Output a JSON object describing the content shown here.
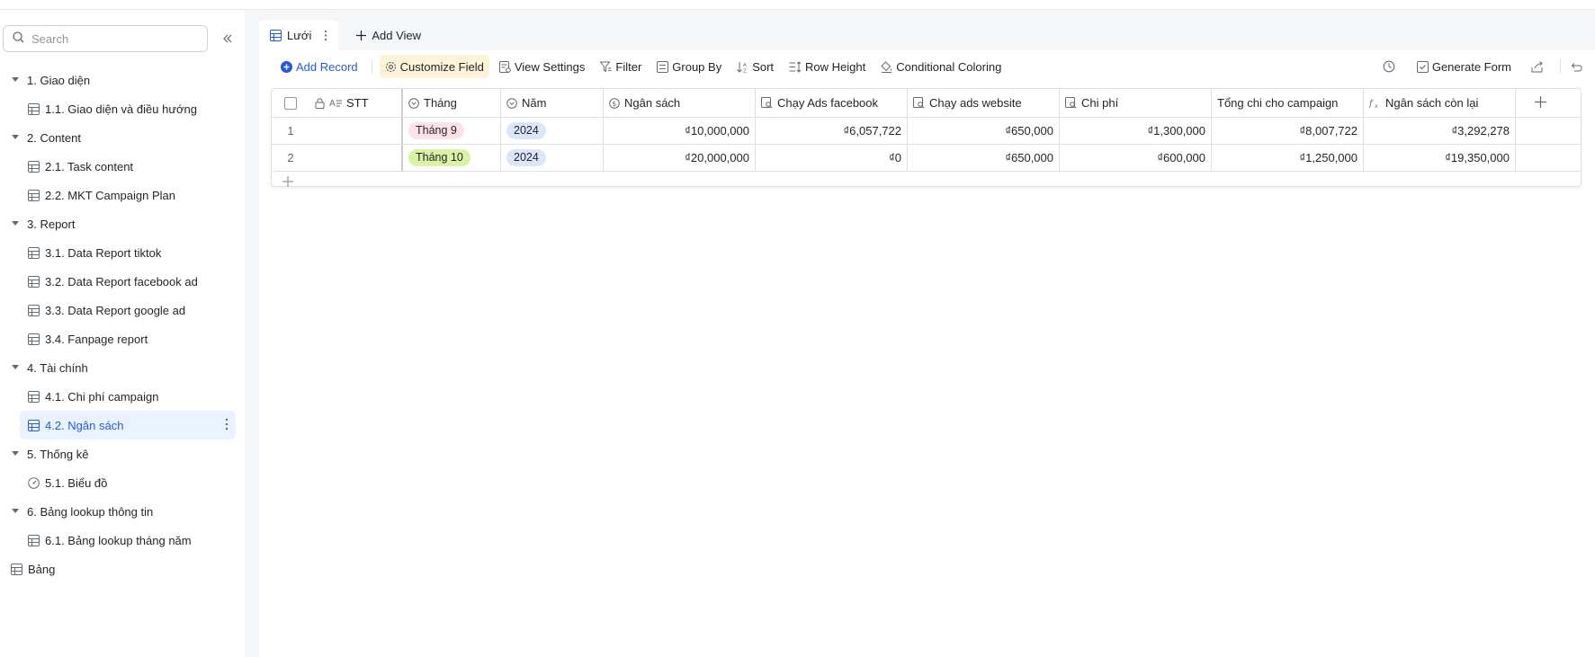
{
  "sidebar": {
    "search_placeholder": "Search",
    "groups": [
      {
        "label": "1. Giao diện",
        "items": [
          "1.1. Giao diện và điều hướng"
        ]
      },
      {
        "label": "2. Content",
        "items": [
          "2.1. Task content",
          "2.2. MKT Campaign Plan"
        ]
      },
      {
        "label": "3. Report",
        "items": [
          "3.1. Data Report tiktok",
          "3.2. Data Report facebook ad",
          "3.3. Data Report google ad",
          "3.4. Fanpage report"
        ]
      },
      {
        "label": "4. Tài chính",
        "items": [
          "4.1. Chi phí campaign",
          "4.2. Ngân sách"
        ]
      },
      {
        "label": "5. Thống kê",
        "items": [
          "5.1. Biểu đồ"
        ]
      },
      {
        "label": "6. Bảng lookup thông tin",
        "items": [
          "6.1. Bảng lookup tháng năm"
        ]
      }
    ],
    "root_item": "Bảng",
    "active_item": "4.2. Ngân sách"
  },
  "tabs": {
    "active": "Lưới",
    "add_view": "Add View"
  },
  "toolbar": {
    "add_record": "Add Record",
    "customize_field": "Customize Field",
    "view_settings": "View Settings",
    "filter": "Filter",
    "group_by": "Group By",
    "sort": "Sort",
    "row_height": "Row Height",
    "conditional_coloring": "Conditional Coloring",
    "generate_form": "Generate Form"
  },
  "table": {
    "headers": [
      "STT",
      "Tháng",
      "Năm",
      "Ngân sách",
      "Chạy Ads facebook",
      "Chạy ads website",
      "Chi phí",
      "Tổng chi cho campaign",
      "Ngân sách còn lại"
    ],
    "rows": [
      {
        "index": "1",
        "stt": "",
        "thang": "Tháng 9",
        "nam": "2024",
        "ngan_sach": "₫10,000,000",
        "ads_facebook": "₫6,057,722",
        "ads_website": "₫650,000",
        "chi_phi": "₫1,300,000",
        "tong_chi": "₫8,007,722",
        "con_lai": "₫3,292,278"
      },
      {
        "index": "2",
        "stt": "",
        "thang": "Tháng 10",
        "nam": "2024",
        "ngan_sach": "₫20,000,000",
        "ads_facebook": "₫0",
        "ads_website": "₫650,000",
        "chi_phi": "₫600,000",
        "tong_chi": "₫1,250,000",
        "con_lai": "₫19,350,000"
      }
    ]
  },
  "colors": {
    "accent": "#245bdb",
    "active_bg": "#eaf1ff",
    "tag_pink": "#fde2e8",
    "tag_green": "#dbf1a3",
    "tag_blue": "#dce6fa"
  }
}
